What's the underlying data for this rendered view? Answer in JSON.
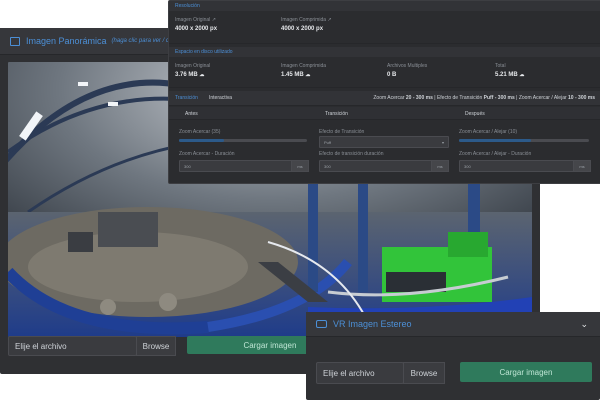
{
  "panorama_panel": {
    "title": "Imagen Panorámica",
    "hint": "(haga clic para ver / cambia",
    "file_input_placeholder": "Elije el archivo",
    "browse_label": "Browse",
    "upload_label": "Cargar imagen"
  },
  "overlay": {
    "resolution_section": "Resolución",
    "original_image_label": "Imagen Original",
    "original_image_value": "4000 x 2000 px",
    "compressed_image_label": "Imagen Comprimida",
    "compressed_image_value": "4000 x 2000 px",
    "storage_section": "Espacio en disco utilizado",
    "storage_original_label": "Imagen Original",
    "storage_original_value": "3.76 MB",
    "storage_compressed_label": "Imagen Comprimida",
    "storage_compressed_value": "1.45 MB",
    "storage_multi_label": "Archivos Multiples",
    "storage_multi_value": "0 B",
    "storage_total_label": "Total",
    "storage_total_value": "5.21 MB",
    "transition_tab": "Transición",
    "transition_tab2": "Interactiva",
    "zoom_summary_prefix": "Zoom Acercar",
    "zoom_summary_a": "20 - 300 ms",
    "zoom_summary_mid": "| Efecto de Transición",
    "zoom_summary_b": "Puff - 300 ms",
    "zoom_summary_mid2": "| Zoom Acercar / Alejar",
    "zoom_summary_c": "10 - 300 ms",
    "col_before": "Antes",
    "col_transition": "Transición",
    "col_after": "Después",
    "zoom_in_label": "Zoom Acercar (35)",
    "effect_label": "Efecto de Transición",
    "effect_value": "Puff",
    "zoom_inout_label": "Zoom Acercar / Alejar (10)",
    "zoom_in_duration_label": "Zoom Acercar - Duración",
    "zoom_in_duration_value": "300",
    "transition_duration_label": "Efecto de transición duración",
    "transition_duration_value": "300",
    "zoom_inout_duration_label": "Zoom Acercar / Alejar - Duración",
    "zoom_inout_duration_value": "300",
    "ms_unit": "ms"
  },
  "vr_panel": {
    "title": "VR Imagen Estereo",
    "file_input_placeholder": "Elije el archivo",
    "browse_label": "Browse",
    "upload_label": "Cargar imagen"
  },
  "sliders": {
    "zoom_in_fraction": 0.35,
    "zoom_inout_fraction": 0.55
  },
  "colors": {
    "accent": "#4c8fd6",
    "panel_bg": "#2f3033",
    "upload_green": "#2f7a5c"
  },
  "icons": {
    "panorama": "image-icon",
    "vr": "vr-goggles-icon",
    "chevron": "chevron-down-icon",
    "external": "external-link-icon"
  }
}
